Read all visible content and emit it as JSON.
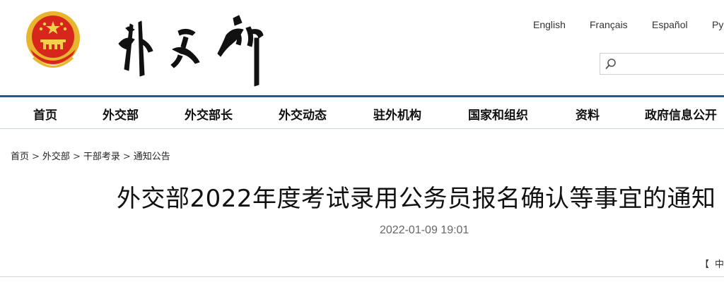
{
  "header": {
    "emblem_icon": "national-emblem-icon",
    "logo_icon": "ministry-calligraphy-logo-icon",
    "languages": [
      "English",
      "Français",
      "Español",
      "Ру"
    ]
  },
  "search": {
    "icon": "search-icon",
    "value": "",
    "placeholder": ""
  },
  "nav": {
    "items": [
      "首页",
      "外交部",
      "外交部长",
      "外交动态",
      "驻外机构",
      "国家和组织",
      "资料",
      "政府信息公开"
    ]
  },
  "breadcrumb": {
    "items": [
      "首页",
      "外交部",
      "干部考录",
      "通知公告"
    ],
    "separator": ">"
  },
  "article": {
    "title": "外交部2022年度考试录用公务员报名确认等事宜的通知",
    "date": "2022-01-09 19:01"
  },
  "font_size_control": {
    "bracket": "【",
    "label": "中"
  },
  "colors": {
    "nav_rule": "#1c5a8e",
    "emblem_red": "#d7261b",
    "emblem_gold": "#e8b52e"
  }
}
